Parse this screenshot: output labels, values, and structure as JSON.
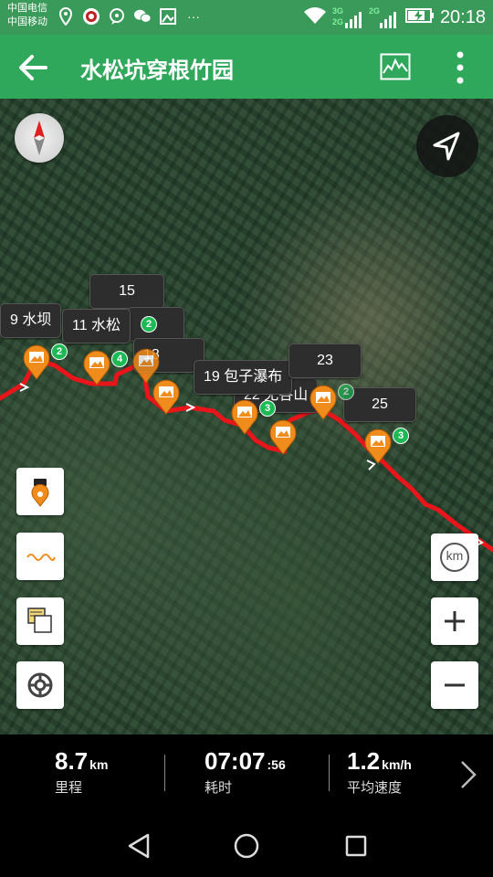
{
  "status_bar": {
    "carrier1": "中国电信",
    "carrier2": "中国移动",
    "network1": "3G",
    "network2": "2G",
    "network3": "2G",
    "time": "20:18",
    "more": "···"
  },
  "app_bar": {
    "title": "水松坑穿根竹园"
  },
  "map": {
    "labels": [
      "9 水坝",
      "11 水松",
      "15",
      "18",
      "19 包子瀑布",
      "22 无各山",
      "23",
      "25"
    ],
    "badges": [
      "2",
      "4",
      "2",
      "3",
      "2",
      "3"
    ],
    "km_label": "km"
  },
  "stats": {
    "distance": {
      "value": "8.7",
      "unit": "km",
      "label": "里程"
    },
    "duration": {
      "value": "07:07",
      "unit": ":56",
      "label": "耗时"
    },
    "speed": {
      "value": "1.2",
      "unit": "km/h",
      "label": "平均速度"
    }
  },
  "colors": {
    "appbar": "#2fa85b",
    "track": "#e8151b",
    "pin": "#f08c1c",
    "badge": "#1db954"
  }
}
